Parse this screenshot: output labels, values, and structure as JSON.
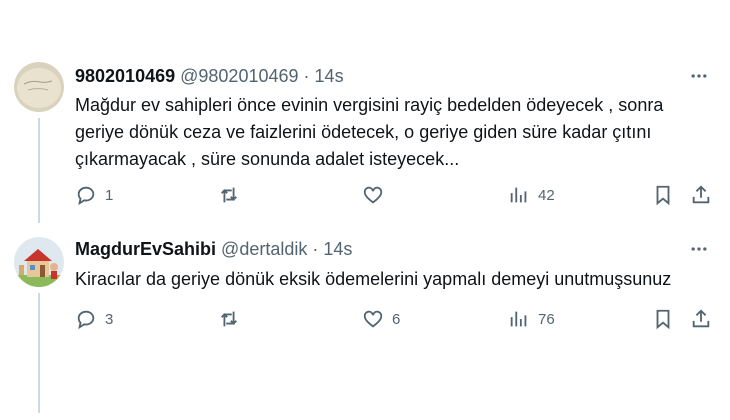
{
  "tweets": [
    {
      "display_name": "9802010469",
      "handle": "@9802010469",
      "separator": "·",
      "time": "14s",
      "text": "Mağdur ev sahipleri önce evinin vergisini rayiç bedelden ödeyecek , sonra geriye dönük ceza ve faizlerini ödetecek, o geriye giden süre kadar çıtını çıkarmayacak , süre sonunda adalet isteyecek...",
      "replies": "1",
      "reposts": "",
      "likes": "",
      "views": "42"
    },
    {
      "display_name": "MagdurEvSahibi",
      "handle": "@dertaldik",
      "separator": "·",
      "time": "14s",
      "text": "Kiracılar da geriye dönük eksik ödemelerini yapmalı demeyi unutmuşsunuz",
      "replies": "3",
      "reposts": "",
      "likes": "6",
      "views": "76"
    }
  ],
  "colors": {
    "text": "#0f1419",
    "secondary": "#536471",
    "thread_line": "#cfd9de"
  },
  "icons": [
    "more-icon",
    "reply-icon",
    "repost-icon",
    "like-icon",
    "views-icon",
    "bookmark-icon",
    "share-icon"
  ]
}
